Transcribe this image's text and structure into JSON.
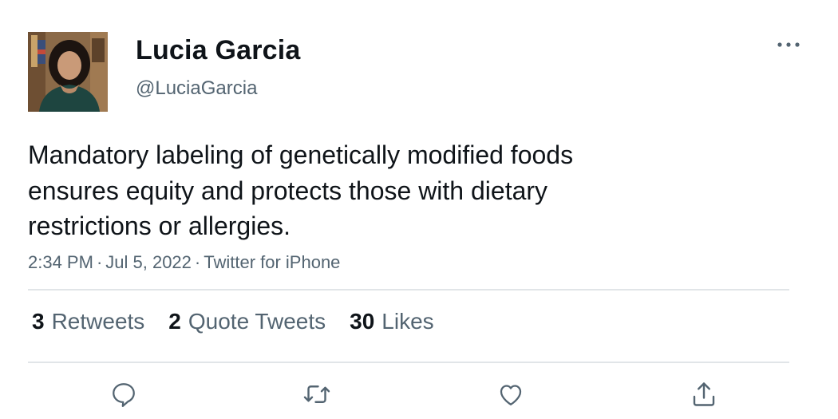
{
  "tweet": {
    "display_name": "Lucia Garcia",
    "handle": "@LuciaGarcia",
    "text_lines": [
      "Mandatory labeling of genetically modified foods",
      "ensures equity and protects those with dietary",
      "restrictions or allergies."
    ],
    "time": "2:34 PM",
    "date": "Jul 5, 2022",
    "separator": "·",
    "source": "Twitter for iPhone"
  },
  "stats": {
    "retweets_count": "3",
    "retweets_label": "Retweets",
    "quotes_count": "2",
    "quotes_label": "Quote Tweets",
    "likes_count": "30",
    "likes_label": "Likes"
  },
  "icons": {
    "more": "more-icon",
    "reply": "reply-icon",
    "retweet": "retweet-icon",
    "like": "heart-icon",
    "share": "share-icon"
  },
  "colors": {
    "text_primary": "#0f1419",
    "text_secondary": "#536471",
    "divider": "#e1e5e8",
    "icon": "#536471"
  }
}
